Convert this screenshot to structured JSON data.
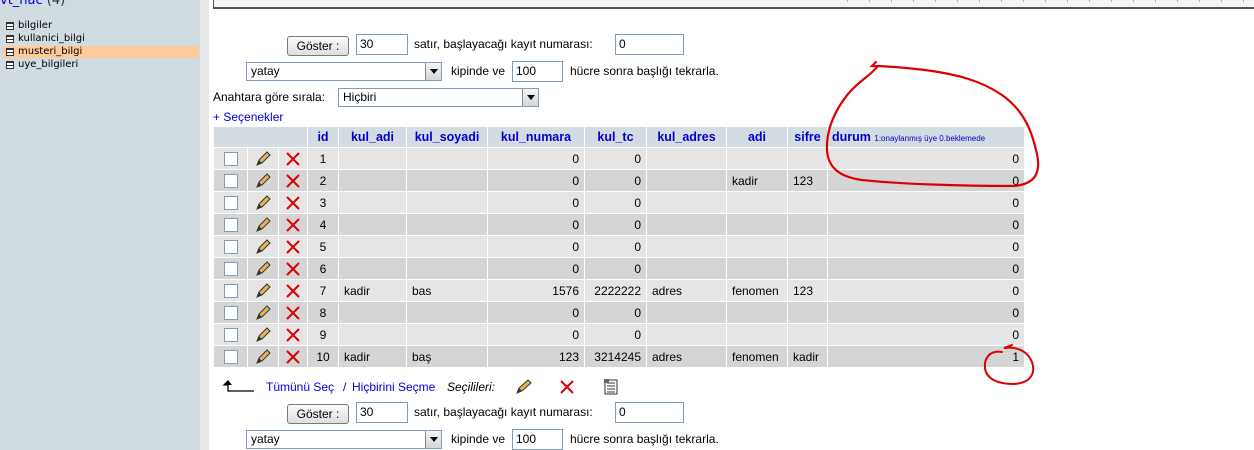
{
  "left_panel": {
    "db_name": "vt_hac",
    "table_count": "(4)",
    "tables": [
      "bilgiler",
      "kullanici_bilgi",
      "musteri_bilgi",
      "uye_bilgileri"
    ],
    "active_table": "musteri_bilgi"
  },
  "nav_top": {
    "show_button": "Göster :",
    "rows_value": "30",
    "rows_label": "satır, başlayacağı kayıt numarası:",
    "start_value": "0",
    "mode_value": "yatay",
    "mode_label": "kipinde ve",
    "repeat_value": "100",
    "repeat_label": "hücre sonra başlığı tekrarla."
  },
  "sort": {
    "label": "Anahtara göre sırala:",
    "value": "Hiçbiri"
  },
  "options_link": "+ Seçenekler",
  "table": {
    "headers": [
      "id",
      "kul_adi",
      "kul_soyadi",
      "kul_numara",
      "kul_tc",
      "kul_adres",
      "adi",
      "sifre",
      "durum"
    ],
    "durum_note": "1:onaylanmış üye 0.beklemede",
    "rows": [
      [
        "1",
        "",
        "",
        "0",
        "0",
        "",
        "",
        "",
        "0"
      ],
      [
        "2",
        "",
        "",
        "0",
        "0",
        "",
        "kadir",
        "123",
        "0"
      ],
      [
        "3",
        "",
        "",
        "0",
        "0",
        "",
        "",
        "",
        "0"
      ],
      [
        "4",
        "",
        "",
        "0",
        "0",
        "",
        "",
        "",
        "0"
      ],
      [
        "5",
        "",
        "",
        "0",
        "0",
        "",
        "",
        "",
        "0"
      ],
      [
        "6",
        "",
        "",
        "0",
        "0",
        "",
        "",
        "",
        "0"
      ],
      [
        "7",
        "kadir",
        "bas",
        "1576",
        "2222222",
        "adres",
        "fenomen",
        "123",
        "0"
      ],
      [
        "8",
        "",
        "",
        "0",
        "0",
        "",
        "",
        "",
        "0"
      ],
      [
        "9",
        "",
        "",
        "0",
        "0",
        "",
        "",
        "",
        "0"
      ],
      [
        "10",
        "kadir",
        "baş",
        "123",
        "3214245",
        "adres",
        "fenomen",
        "kadir",
        "1"
      ]
    ]
  },
  "bulk": {
    "select_all": "Tümünü Seç",
    "separator": "/",
    "select_none": "Hiçbirini Seçme",
    "selected_label": "Seçilileri:"
  },
  "nav_bottom": {
    "show_button": "Göster :",
    "rows_value": "30",
    "rows_label": "satır, başlayacağı kayıt numarası:",
    "start_value": "0",
    "mode_value": "yatay",
    "mode_label": "kipinde ve",
    "repeat_value": "100",
    "repeat_label": "hücre sonra başlığı tekrarla."
  },
  "colors": {
    "header_bg": "#d3dce3",
    "link": "#0000cc",
    "row_odd": "#e5e5e5",
    "row_even": "#d5d5d5",
    "active_table_bg": "#ffcc99",
    "annotation": "#dd0000"
  },
  "icons": [
    "table-icon",
    "checkbox-icon",
    "edit-pencil-icon",
    "delete-x-icon",
    "export-icon",
    "select-arrow-icon"
  ]
}
